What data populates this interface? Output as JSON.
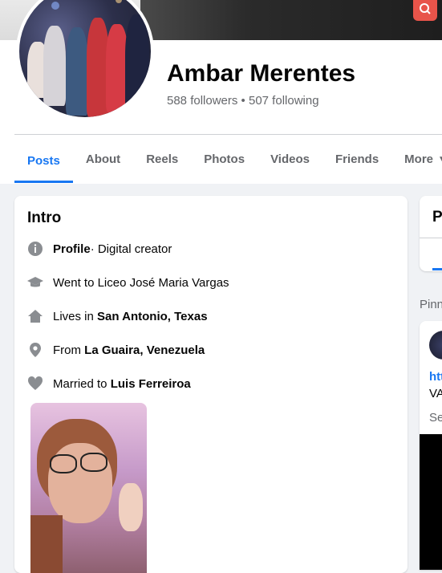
{
  "profile": {
    "name": "Ambar Merentes",
    "followers_label": "588 followers",
    "separator": " • ",
    "following_label": "507 following"
  },
  "tabs": [
    {
      "label": "Posts",
      "active": true
    },
    {
      "label": "About"
    },
    {
      "label": "Reels"
    },
    {
      "label": "Photos"
    },
    {
      "label": "Videos"
    },
    {
      "label": "Friends"
    },
    {
      "label": "More"
    }
  ],
  "intro": {
    "title": "Intro",
    "profile_prefix": "Profile",
    "profile_suffix": " · Digital creator",
    "education": "Went to Liceo José Maria Vargas",
    "lives_prefix": "Lives in ",
    "lives_city": "San Antonio, Texas",
    "from_prefix": "From ",
    "from_city": "La Guaira, Venezuela",
    "married_prefix": "Married to ",
    "married_name": "Luis Ferreiroa"
  },
  "right": {
    "card_title_partial": "P",
    "pinned_partial": "Pinn",
    "post_link_partial": "htt",
    "post_text_partial": "VA",
    "see_partial": "Se"
  },
  "colors": {
    "accent": "#1877f2",
    "secondary_text": "#65676b",
    "background": "#f0f2f5",
    "cover_button": "#e8544a"
  }
}
